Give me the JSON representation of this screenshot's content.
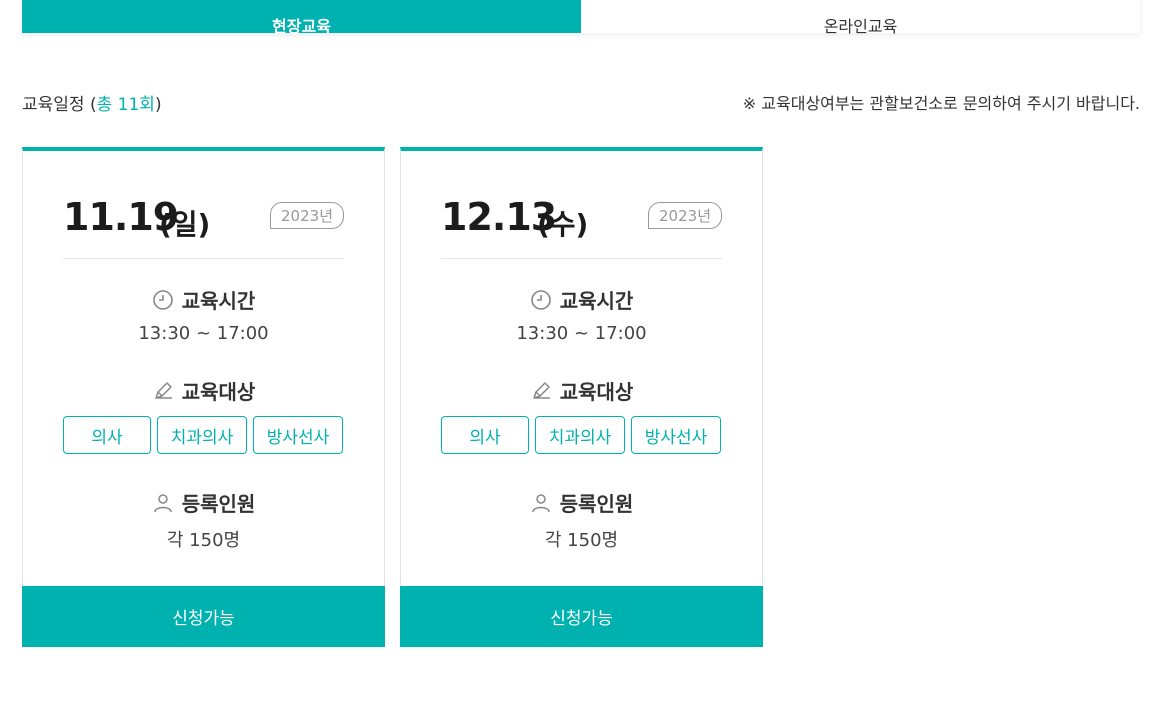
{
  "tabs": [
    {
      "label": "현장교육",
      "active": true
    },
    {
      "label": "온라인교육",
      "active": false
    }
  ],
  "schedule": {
    "label": "교육일정",
    "open_paren": "(",
    "total": "총 11회",
    "close_paren": ")"
  },
  "notice": "※ 교육대상여부는 관할보건소로 문의하여 주시기 바랍니다.",
  "labels": {
    "time": "교육시간",
    "target": "교육대상",
    "capacity": "등록인원"
  },
  "icons": {
    "time": "clock-icon",
    "target": "pencil-icon",
    "capacity": "person-icon"
  },
  "cards": [
    {
      "date": "11.19",
      "dow": "(일)",
      "year": "2023년",
      "time": "13:30 ~ 17:00",
      "targets": [
        "의사",
        "치과의사",
        "방사선사"
      ],
      "capacity": "각 150명",
      "button": "신청가능"
    },
    {
      "date": "12.13",
      "dow": "(수)",
      "year": "2023년",
      "time": "13:30 ~ 17:00",
      "targets": [
        "의사",
        "치과의사",
        "방사선사"
      ],
      "capacity": "각 150명",
      "button": "신청가능"
    }
  ],
  "colors": {
    "accent": "#00b2af",
    "text": "#333333"
  }
}
